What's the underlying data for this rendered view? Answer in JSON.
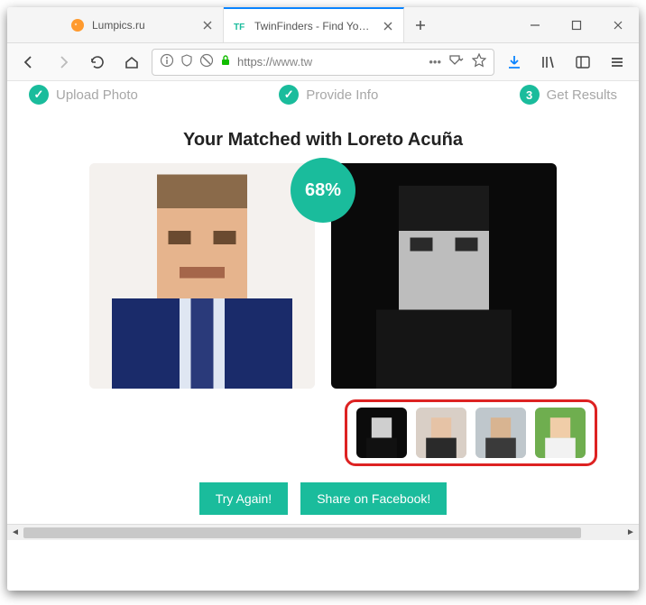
{
  "window": {
    "tabs": [
      {
        "title": "Lumpics.ru",
        "active": false
      },
      {
        "title": "TwinFinders - Find Your Twin",
        "active": true
      }
    ],
    "url_scheme": "https://",
    "url_host": "www.tw",
    "minimize": "—",
    "maximize": "☐",
    "close": "✕"
  },
  "page": {
    "steps": [
      {
        "label": "Upload Photo",
        "mark": "✓"
      },
      {
        "label": "Provide Info",
        "mark": "✓"
      },
      {
        "label": "Get Results",
        "mark": "3"
      }
    ],
    "heading": "Your Matched with Loreto Acuña",
    "match_percent": "68%",
    "thumbs": [
      "thumb-1",
      "thumb-2",
      "thumb-3",
      "thumb-4"
    ],
    "actions": {
      "try_again": "Try Again!",
      "share_fb": "Share on Facebook!"
    }
  }
}
